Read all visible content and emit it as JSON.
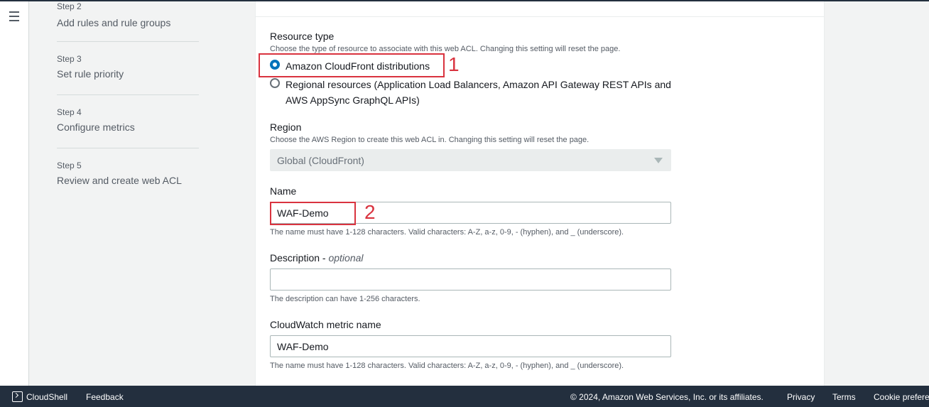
{
  "steps": [
    {
      "num": "Step 2",
      "title": "Add rules and rule groups"
    },
    {
      "num": "Step 3",
      "title": "Set rule priority"
    },
    {
      "num": "Step 4",
      "title": "Configure metrics"
    },
    {
      "num": "Step 5",
      "title": "Review and create web ACL"
    }
  ],
  "resource_type": {
    "label": "Resource type",
    "description": "Choose the type of resource to associate with this web ACL. Changing this setting will reset the page.",
    "options": [
      {
        "label": "Amazon CloudFront distributions",
        "checked": true
      },
      {
        "label": "Regional resources (Application Load Balancers, Amazon API Gateway REST APIs and AWS AppSync GraphQL APIs)",
        "checked": false
      }
    ]
  },
  "region": {
    "label": "Region",
    "description": "Choose the AWS Region to create this web ACL in. Changing this setting will reset the page.",
    "value": "Global (CloudFront)"
  },
  "name": {
    "label": "Name",
    "value": "WAF-Demo",
    "hint": "The name must have 1-128 characters. Valid characters: A-Z, a-z, 0-9, - (hyphen), and _ (underscore)."
  },
  "description_field": {
    "label": "Description - ",
    "label_optional": "optional",
    "value": "",
    "hint": "The description can have 1-256 characters."
  },
  "cloudwatch": {
    "label": "CloudWatch metric name",
    "value": "WAF-Demo",
    "hint": "The name must have 1-128 characters. Valid characters: A-Z, a-z, 0-9, - (hyphen), and _ (underscore)."
  },
  "annotations": {
    "marker1": "1",
    "marker2": "2",
    "color": "#d9333f"
  },
  "footer": {
    "cloudshell": "CloudShell",
    "feedback": "Feedback",
    "copyright": "© 2024, Amazon Web Services, Inc. or its affiliates.",
    "privacy": "Privacy",
    "terms": "Terms",
    "cookie": "Cookie prefere"
  },
  "colors": {
    "accent": "#0073bb",
    "footer_bg": "#232f3e"
  }
}
